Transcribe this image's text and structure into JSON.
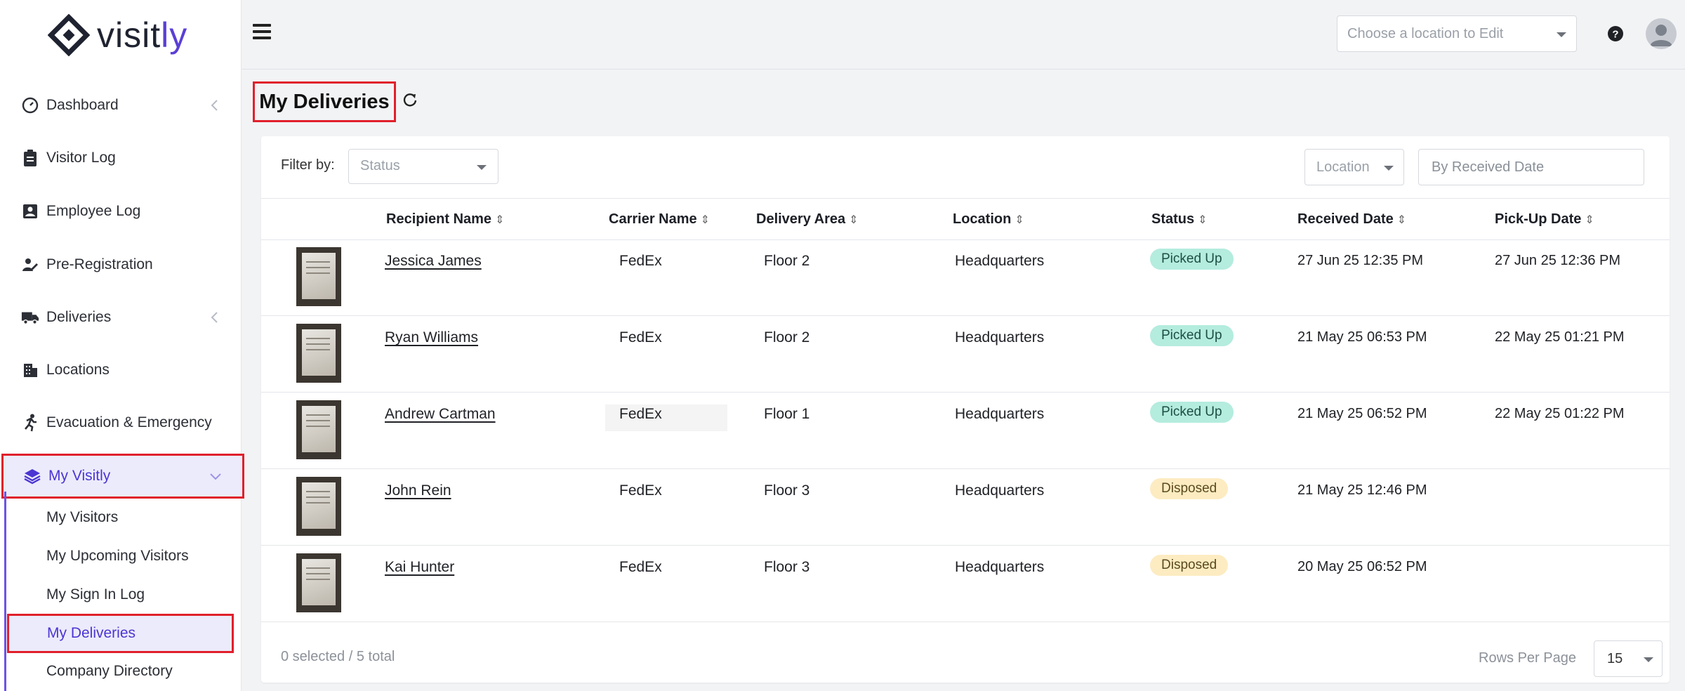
{
  "brand": {
    "name_main": "visit",
    "name_accent": "ly"
  },
  "sidebar": {
    "items": [
      {
        "label": "Dashboard",
        "icon": "dashboard-gauge-icon",
        "has_chevron": true
      },
      {
        "label": "Visitor Log",
        "icon": "clipboard-icon",
        "has_chevron": false
      },
      {
        "label": "Employee Log",
        "icon": "id-badge-icon",
        "has_chevron": false
      },
      {
        "label": "Pre-Registration",
        "icon": "user-edit-icon",
        "has_chevron": false
      },
      {
        "label": "Deliveries",
        "icon": "truck-icon",
        "has_chevron": true
      },
      {
        "label": "Locations",
        "icon": "building-icon",
        "has_chevron": false
      },
      {
        "label": "Evacuation & Emergency",
        "icon": "running-person-icon",
        "has_chevron": false
      },
      {
        "label": "My Visitly",
        "icon": "layers-icon",
        "has_chevron": true,
        "active": true
      }
    ],
    "submenu": [
      {
        "label": "My Visitors"
      },
      {
        "label": "My Upcoming Visitors"
      },
      {
        "label": "My Sign In Log"
      },
      {
        "label": "My Deliveries",
        "active": true
      },
      {
        "label": "Company Directory"
      }
    ]
  },
  "topbar": {
    "location_placeholder": "Choose a location to Edit"
  },
  "page": {
    "title": "My Deliveries"
  },
  "filters": {
    "filter_by_label": "Filter by:",
    "status_placeholder": "Status",
    "location_placeholder": "Location",
    "date_placeholder": "By Received Date"
  },
  "table": {
    "columns": [
      "Recipient Name",
      "Carrier Name",
      "Delivery Area",
      "Location",
      "Status",
      "Received Date",
      "Pick-Up Date"
    ],
    "rows": [
      {
        "recipient": "Jessica James",
        "carrier": "FedEx",
        "area": "Floor 2",
        "location": "Headquarters",
        "status": "Picked Up",
        "received": "27 Jun 25 12:35 PM",
        "pickup": "27 Jun 25 12:36 PM"
      },
      {
        "recipient": "Ryan Williams",
        "carrier": "FedEx",
        "area": "Floor 2",
        "location": "Headquarters",
        "status": "Picked Up",
        "received": "21 May 25 06:53 PM",
        "pickup": "22 May 25 01:21 PM"
      },
      {
        "recipient": "Andrew Cartman",
        "carrier": "FedEx",
        "area": "Floor 1",
        "location": "Headquarters",
        "status": "Picked Up",
        "received": "21 May 25 06:52 PM",
        "pickup": "22 May 25 01:22 PM"
      },
      {
        "recipient": "John Rein",
        "carrier": "FedEx",
        "area": "Floor 3",
        "location": "Headquarters",
        "status": "Disposed",
        "received": "21 May 25 12:46 PM",
        "pickup": ""
      },
      {
        "recipient": "Kai Hunter",
        "carrier": "FedEx",
        "area": "Floor 3",
        "location": "Headquarters",
        "status": "Disposed",
        "received": "20 May 25 06:52 PM",
        "pickup": ""
      }
    ]
  },
  "footer": {
    "selection_text": "0 selected / 5 total",
    "rows_per_page_label": "Rows Per Page",
    "rows_per_page_value": "15"
  },
  "colors": {
    "accent": "#5b3fd6",
    "highlight_border": "#e0202b",
    "picked_up_badge": "#b4ecde",
    "disposed_badge": "#fdecc2"
  }
}
